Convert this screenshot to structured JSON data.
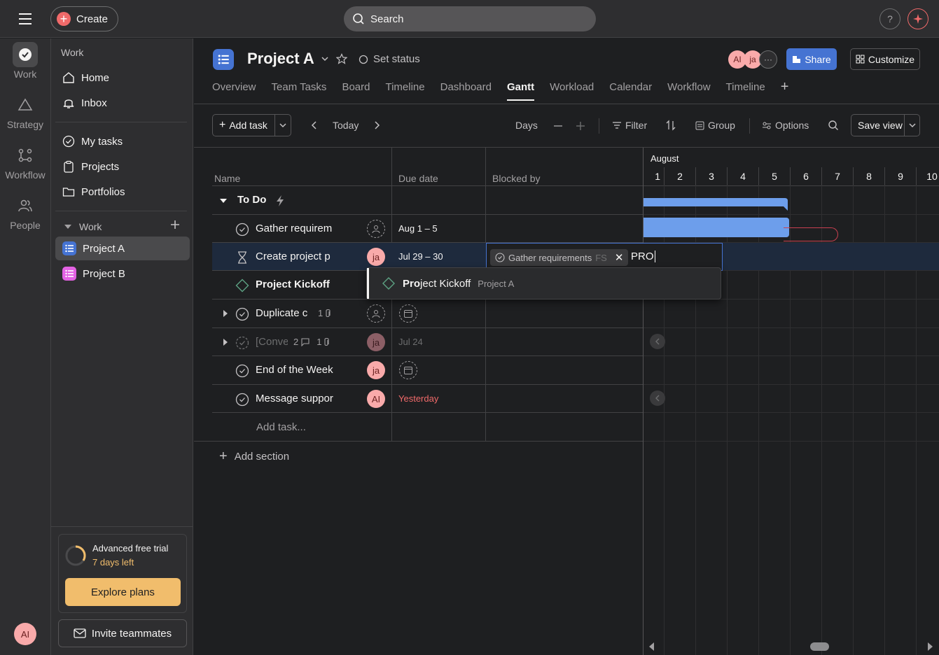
{
  "topbar": {
    "create_label": "Create",
    "search_placeholder": "Search",
    "help_label": "?"
  },
  "rail": {
    "items": [
      {
        "label": "Work",
        "icon": "check-circle-icon"
      },
      {
        "label": "Strategy",
        "icon": "triangle-icon"
      },
      {
        "label": "Workflow",
        "icon": "workflow-icon"
      },
      {
        "label": "People",
        "icon": "people-icon"
      }
    ],
    "avatar": "AI"
  },
  "sidebar": {
    "heading": "Work",
    "nav": [
      {
        "label": "Home",
        "icon": "home-icon"
      },
      {
        "label": "Inbox",
        "icon": "bell-icon"
      }
    ],
    "mine": [
      {
        "label": "My tasks",
        "icon": "check-circle-icon"
      },
      {
        "label": "Projects",
        "icon": "clipboard-icon"
      },
      {
        "label": "Portfolios",
        "icon": "folder-icon"
      }
    ],
    "section_label": "Work",
    "projects": [
      {
        "label": "Project A",
        "color": "#4573d2",
        "active": true
      },
      {
        "label": "Project B",
        "color": "#e362e3",
        "active": false
      }
    ],
    "trial_title": "Advanced free trial",
    "trial_sub": "7 days left",
    "explore_label": "Explore plans",
    "invite_label": "Invite teammates"
  },
  "header": {
    "title": "Project A",
    "set_status": "Set status",
    "avatars": [
      "AI",
      "ja"
    ],
    "share_label": "Share",
    "customize_label": "Customize",
    "tabs": [
      "Overview",
      "Team Tasks",
      "Board",
      "Timeline",
      "Dashboard",
      "Gantt",
      "Workload",
      "Calendar",
      "Workflow",
      "Timeline"
    ],
    "active_tab": "Gantt"
  },
  "toolbar": {
    "add_task": "Add task",
    "today": "Today",
    "days": "Days",
    "filter": "Filter",
    "group": "Group",
    "options": "Options",
    "save_view": "Save view"
  },
  "list": {
    "col_name": "Name",
    "col_due": "Due date",
    "col_blocked": "Blocked by",
    "section": "To Do",
    "tasks": [
      {
        "name": "Gather requirem",
        "due": "Aug 1 – 5",
        "assignee": "",
        "kind": "check"
      },
      {
        "name": "Create project p",
        "due": "Jul 29 – 30",
        "assignee": "ja",
        "kind": "hourglass"
      },
      {
        "name": "Project Kickoff",
        "due": "",
        "assignee": "",
        "kind": "milestone"
      },
      {
        "name": "Duplicate c",
        "due": "",
        "assignee": "",
        "kind": "check",
        "counts": "1"
      },
      {
        "name": "[Conve",
        "due": "Jul 24",
        "assignee": "ja",
        "kind": "check",
        "counts": "2",
        "counts2": "1"
      },
      {
        "name": "End of the Week",
        "due": "",
        "assignee": "ja",
        "kind": "check"
      },
      {
        "name": "Message suppor",
        "due": "Yesterday",
        "assignee": "AI",
        "kind": "check"
      }
    ],
    "add_task": "Add task...",
    "add_section": "Add section"
  },
  "dependency": {
    "chip_label": "Gather requirements",
    "chip_type": "FS",
    "input_value": "PRO",
    "suggestion_bold": "Pro",
    "suggestion_rest": "ject Kickoff",
    "suggestion_project": "Project A"
  },
  "gantt": {
    "month": "August",
    "days": [
      "1",
      "2",
      "3",
      "4",
      "5",
      "6",
      "7",
      "8",
      "9",
      "10"
    ]
  }
}
